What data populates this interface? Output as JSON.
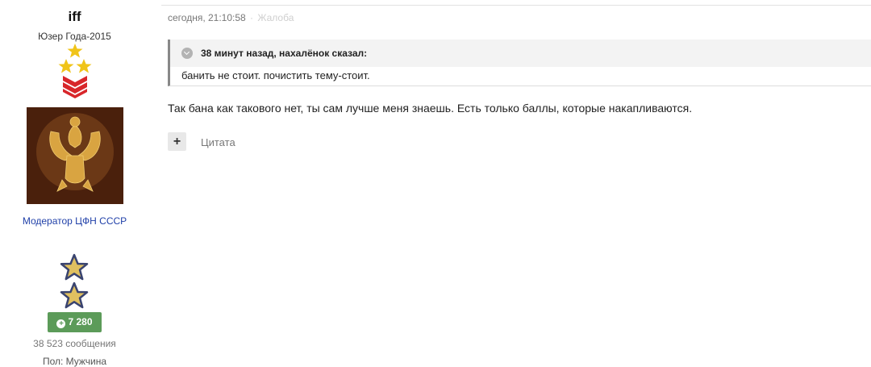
{
  "author": {
    "username": "iff",
    "title": "Юзер Года-2015",
    "group": "Модератор ЦФН СССР",
    "reputation": "7 280",
    "post_count": "38 523 сообщения",
    "gender": "Пол: Мужчина",
    "rank_icon": "rank-stars-chevrons",
    "award_icon": "two-stars-award"
  },
  "post": {
    "timestamp": "сегодня, 21:10:58",
    "separator": "·",
    "report_label": "Жалоба",
    "quote": {
      "header": "38 минут назад, нахалёнок сказал:",
      "text": "банить не стоит. почистить тему-стоит."
    },
    "body": "Так бана как такового нет, ты сам лучше меня знаешь. Есть только баллы, которые накапливаются.",
    "multiquote_label": "+",
    "quote_label": "Цитата"
  },
  "colors": {
    "rep_badge": "#5c9b59",
    "group_link": "#1f3fa8",
    "star_gold": "#f0c419",
    "chevron_red": "#d8262a"
  }
}
